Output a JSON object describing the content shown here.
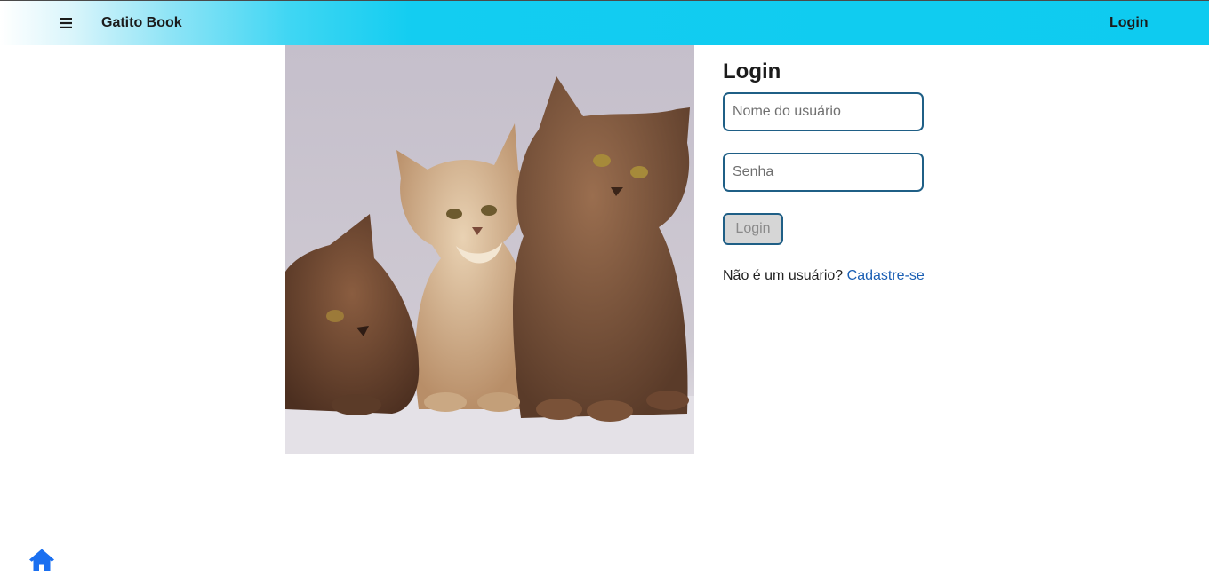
{
  "header": {
    "menu_icon": "hamburger-icon",
    "brand": "Gatito Book",
    "login_link": "Login"
  },
  "hero": {
    "icon": "kittens-photo"
  },
  "login_form": {
    "title": "Login",
    "username_placeholder": "Nome do usuário",
    "username_value": "",
    "password_placeholder": "Senha",
    "password_value": "",
    "submit_label": "Login",
    "signup_prompt": "Não é um usuário?",
    "signup_link": "Cadastre-se"
  },
  "footer": {
    "home_icon": "home-icon"
  },
  "colors": {
    "header_accent": "#0ecbf0",
    "field_border": "#1f5f86",
    "link": "#1a5fb4",
    "home_icon": "#1a6ff0"
  }
}
